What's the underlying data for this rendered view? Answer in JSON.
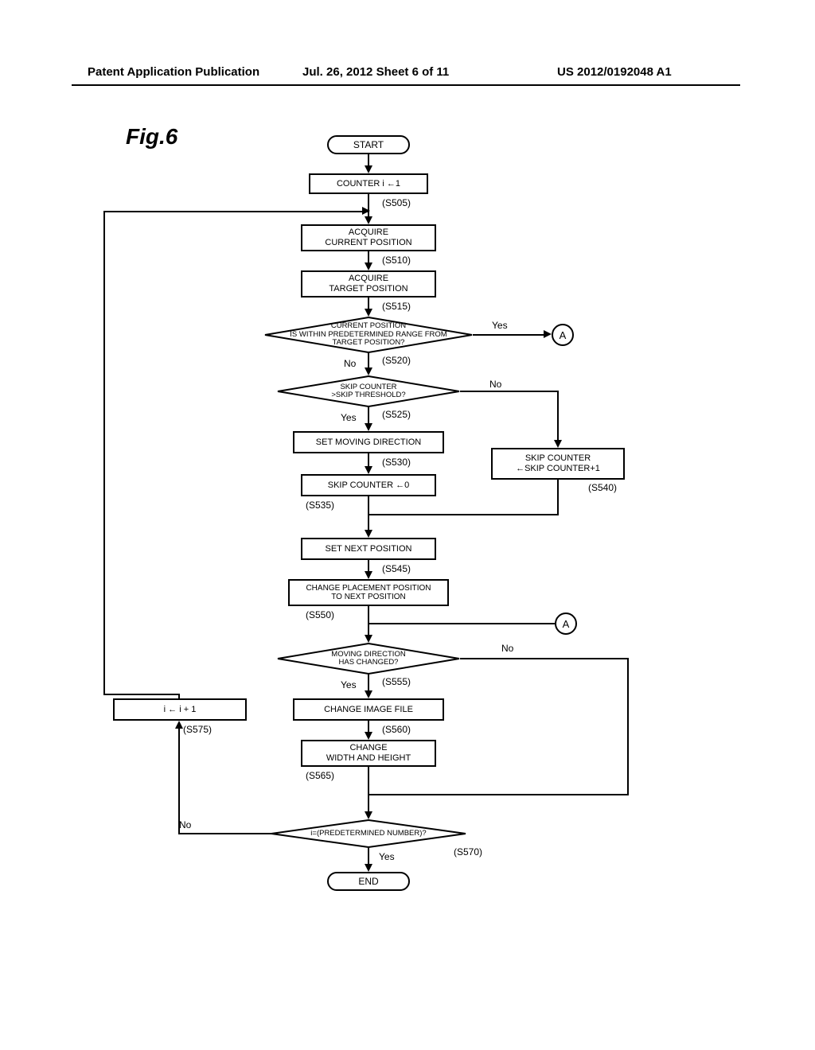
{
  "header": {
    "left": "Patent Application Publication",
    "center": "Jul. 26, 2012   Sheet 6 of 11",
    "right": "US 2012/0192048 A1"
  },
  "figure_label": "Fig.6",
  "nodes": {
    "start": "START",
    "end": "END",
    "counter_init": "COUNTER i ←1",
    "acquire_current": "ACQUIRE\nCURRENT POSITION",
    "acquire_target": "ACQUIRE\nTARGET POSITION",
    "dec_range": "CURRENT POSITION\nIS WITHIN PREDETERMINED RANGE FROM\nTARGET POSITION?",
    "dec_skip": "SKIP COUNTER\n>SKIP THRESHOLD?",
    "set_dir": "SET MOVING DIRECTION",
    "skip_zero": "SKIP COUNTER ←0",
    "skip_inc": "SKIP COUNTER\n←SKIP COUNTER+1",
    "set_next": "SET NEXT POSITION",
    "change_place": "CHANGE PLACEMENT POSITION\nTO NEXT POSITION",
    "dec_dir": "MOVING DIRECTION\nHAS CHANGED?",
    "change_img": "CHANGE IMAGE FILE",
    "change_wh": "CHANGE\nWIDTH AND HEIGHT",
    "dec_i": "i=(PREDETERMINED NUMBER)?",
    "i_inc": "i ← i + 1",
    "connA": "A"
  },
  "steps": {
    "s505": "(S505)",
    "s510": "(S510)",
    "s515": "(S515)",
    "s520": "(S520)",
    "s525": "(S525)",
    "s530": "(S530)",
    "s535": "(S535)",
    "s540": "(S540)",
    "s545": "(S545)",
    "s550": "(S550)",
    "s555": "(S555)",
    "s560": "(S560)",
    "s565": "(S565)",
    "s570": "(S570)",
    "s575": "(S575)"
  },
  "branches": {
    "yes": "Yes",
    "no": "No"
  }
}
